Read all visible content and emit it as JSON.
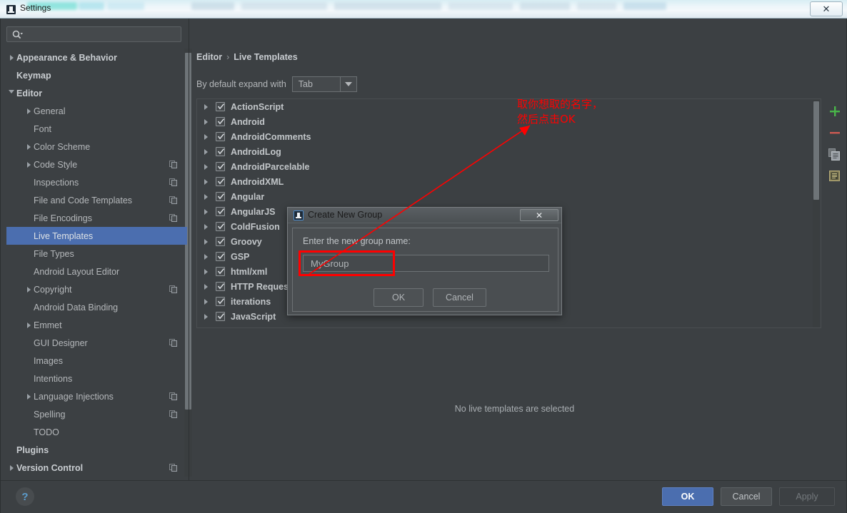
{
  "window": {
    "title": "Settings",
    "app_icon": "intellij-idea-icon",
    "close_label": "✕"
  },
  "sidebar": {
    "search": {
      "value": "",
      "placeholder": "",
      "icon": "search-icon"
    },
    "items": [
      {
        "label": "Appearance & Behavior",
        "level": 1,
        "arrow": "right",
        "bold": true,
        "badge": false,
        "selected": false
      },
      {
        "label": "Keymap",
        "level": 1,
        "arrow": "none",
        "bold": true,
        "badge": false,
        "selected": false
      },
      {
        "label": "Editor",
        "level": 1,
        "arrow": "down",
        "bold": true,
        "badge": false,
        "selected": false
      },
      {
        "label": "General",
        "level": 2,
        "arrow": "right",
        "bold": false,
        "badge": false,
        "selected": false
      },
      {
        "label": "Font",
        "level": 2,
        "arrow": "none",
        "bold": false,
        "badge": false,
        "selected": false
      },
      {
        "label": "Color Scheme",
        "level": 2,
        "arrow": "right",
        "bold": false,
        "badge": false,
        "selected": false
      },
      {
        "label": "Code Style",
        "level": 2,
        "arrow": "right",
        "bold": false,
        "badge": true,
        "selected": false
      },
      {
        "label": "Inspections",
        "level": 2,
        "arrow": "none",
        "bold": false,
        "badge": true,
        "selected": false
      },
      {
        "label": "File and Code Templates",
        "level": 2,
        "arrow": "none",
        "bold": false,
        "badge": true,
        "selected": false
      },
      {
        "label": "File Encodings",
        "level": 2,
        "arrow": "none",
        "bold": false,
        "badge": true,
        "selected": false
      },
      {
        "label": "Live Templates",
        "level": 2,
        "arrow": "none",
        "bold": false,
        "badge": false,
        "selected": true
      },
      {
        "label": "File Types",
        "level": 2,
        "arrow": "none",
        "bold": false,
        "badge": false,
        "selected": false
      },
      {
        "label": "Android Layout Editor",
        "level": 2,
        "arrow": "none",
        "bold": false,
        "badge": false,
        "selected": false
      },
      {
        "label": "Copyright",
        "level": 2,
        "arrow": "right",
        "bold": false,
        "badge": true,
        "selected": false
      },
      {
        "label": "Android Data Binding",
        "level": 2,
        "arrow": "none",
        "bold": false,
        "badge": false,
        "selected": false
      },
      {
        "label": "Emmet",
        "level": 2,
        "arrow": "right",
        "bold": false,
        "badge": false,
        "selected": false
      },
      {
        "label": "GUI Designer",
        "level": 2,
        "arrow": "none",
        "bold": false,
        "badge": true,
        "selected": false
      },
      {
        "label": "Images",
        "level": 2,
        "arrow": "none",
        "bold": false,
        "badge": false,
        "selected": false
      },
      {
        "label": "Intentions",
        "level": 2,
        "arrow": "none",
        "bold": false,
        "badge": false,
        "selected": false
      },
      {
        "label": "Language Injections",
        "level": 2,
        "arrow": "right",
        "bold": false,
        "badge": true,
        "selected": false
      },
      {
        "label": "Spelling",
        "level": 2,
        "arrow": "none",
        "bold": false,
        "badge": true,
        "selected": false
      },
      {
        "label": "TODO",
        "level": 2,
        "arrow": "none",
        "bold": false,
        "badge": false,
        "selected": false
      },
      {
        "label": "Plugins",
        "level": 1,
        "arrow": "none",
        "bold": true,
        "badge": false,
        "selected": false
      },
      {
        "label": "Version Control",
        "level": 1,
        "arrow": "right",
        "bold": true,
        "badge": true,
        "selected": false
      }
    ]
  },
  "main": {
    "breadcrumb": {
      "parent": "Editor",
      "separator": "›",
      "current": "Live Templates"
    },
    "expand_with": {
      "label": "By default expand with",
      "value": "Tab"
    },
    "templates": [
      {
        "label": "ActionScript",
        "checked": true
      },
      {
        "label": "Android",
        "checked": true
      },
      {
        "label": "AndroidComments",
        "checked": true
      },
      {
        "label": "AndroidLog",
        "checked": true
      },
      {
        "label": "AndroidParcelable",
        "checked": true
      },
      {
        "label": "AndroidXML",
        "checked": true
      },
      {
        "label": "Angular",
        "checked": true
      },
      {
        "label": "AngularJS",
        "checked": true
      },
      {
        "label": "ColdFusion",
        "checked": true
      },
      {
        "label": "Groovy",
        "checked": true
      },
      {
        "label": "GSP",
        "checked": true
      },
      {
        "label": "html/xml",
        "checked": true
      },
      {
        "label": "HTTP Request",
        "checked": true
      },
      {
        "label": "iterations",
        "checked": true
      },
      {
        "label": "JavaScript",
        "checked": true
      }
    ],
    "toolbar_icons": [
      {
        "name": "add-icon",
        "glyph": "+"
      },
      {
        "name": "remove-icon",
        "glyph": "−"
      },
      {
        "name": "copy-icon",
        "glyph": ""
      },
      {
        "name": "edit-icon",
        "glyph": ""
      }
    ],
    "empty_message": "No live templates are selected"
  },
  "footer": {
    "help": "?",
    "ok": "OK",
    "cancel": "Cancel",
    "apply": "Apply"
  },
  "dialog": {
    "title": "Create New Group",
    "icon": "intellij-idea-icon",
    "close_label": "✕",
    "prompt": "Enter the new group name:",
    "input_value": "MyGroup",
    "ok": "OK",
    "cancel": "Cancel"
  },
  "annotation": {
    "line1": "取你想取的名字，",
    "line2": "然后点击OK",
    "color": "#ff0000"
  },
  "colors": {
    "background": "#3c4043",
    "selection": "#4b6eaf",
    "text": "#b4b7ba",
    "accent_green": "#49b649",
    "accent_red": "#cc5a52",
    "annotation_red": "#ff0000"
  }
}
